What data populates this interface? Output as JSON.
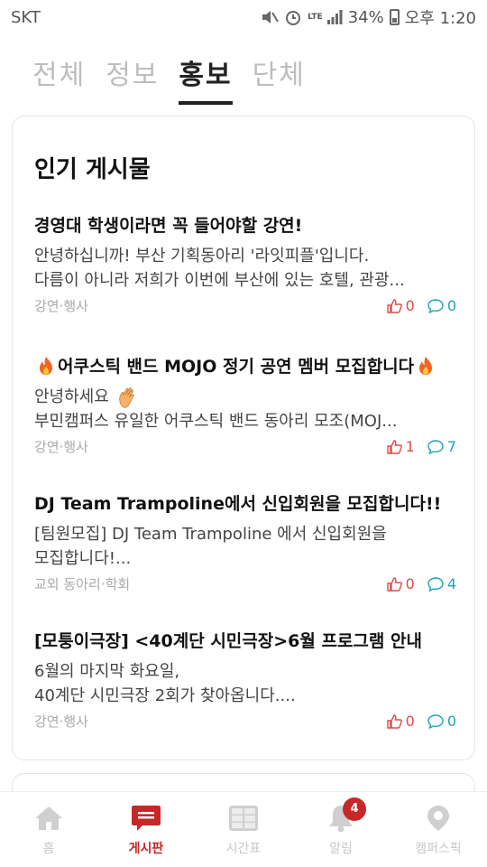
{
  "status_bar": {
    "carrier": "SKT",
    "network": "LTE",
    "battery": "34%",
    "time": "오후 1:20"
  },
  "tabs": [
    {
      "label": "전체",
      "active": false
    },
    {
      "label": "정보",
      "active": false
    },
    {
      "label": "홍보",
      "active": true
    },
    {
      "label": "단체",
      "active": false
    }
  ],
  "section_title": "인기 게시물",
  "posts": [
    {
      "title": "경영대 학생이라면 꼭 들어야할 강연!",
      "lines": [
        "안녕하십니까! 부산 기획동아리 '라잇피플'입니다.",
        "다름이 아니라 저희가 이번에 부산에 있는 호텔, 관광..."
      ],
      "category": "강연·행사",
      "likes": "0",
      "comments": "0"
    },
    {
      "title": "어쿠스틱 밴드 MOJO 정기 공연 멤버 모집합니다",
      "lines": [
        "안녕하세요",
        "부민캠퍼스 유일한 어쿠스틱 밴드 동아리 모조(MOJ..."
      ],
      "category": "강연·행사",
      "likes": "1",
      "comments": "7"
    },
    {
      "title": "DJ Team Trampoline에서 신입회원을 모집합니다!!",
      "lines": [
        "[팀원모집] DJ Team Trampoline 에서 신입회원을",
        "모집합니다!..."
      ],
      "category": "교외 동아리·학회",
      "likes": "0",
      "comments": "4"
    },
    {
      "title": "[모퉁이극장] <40계단 시민극장>6월 프로그램 안내",
      "lines": [
        "6월의 마지막 화요일,",
        "40계단 시민극장 2회가 찾아옵니다...."
      ],
      "category": "강연·행사",
      "likes": "0",
      "comments": "0"
    }
  ],
  "bottom_nav": [
    {
      "label": "홈",
      "icon": "home-icon",
      "active": false
    },
    {
      "label": "게시판",
      "icon": "board-icon",
      "active": true
    },
    {
      "label": "시간표",
      "icon": "timetable-icon",
      "active": false
    },
    {
      "label": "알림",
      "icon": "bell-icon",
      "active": false,
      "badge": "4"
    },
    {
      "label": "캠퍼스픽",
      "icon": "campuspick-icon",
      "active": false
    }
  ],
  "colors": {
    "accent": "#c62828",
    "like": "#e04a4a",
    "comment": "#1ba4b8",
    "inactive": "#c8c8c8"
  }
}
